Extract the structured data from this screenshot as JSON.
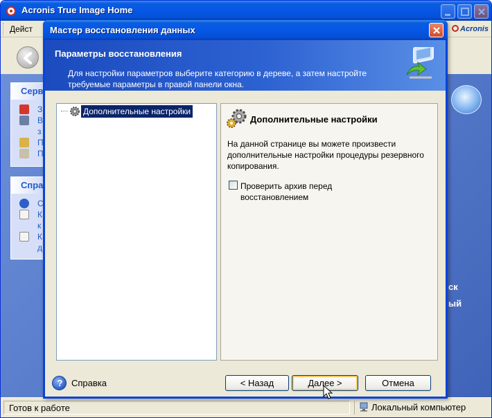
{
  "main_window": {
    "title": "Acronis True Image Home",
    "menu_action": "Дейст",
    "brand": "Acronis",
    "status_text": "Готов к работе",
    "status_computer": "Локальный компьютер"
  },
  "sidebar": {
    "services": {
      "heading": "Серв",
      "items": [
        {
          "text": "З",
          "icon": "restore-icon"
        },
        {
          "text": "В",
          "icon": "wizard-icon"
        },
        {
          "text": "з",
          "icon": ""
        },
        {
          "text": "П",
          "icon": "tasks-icon"
        },
        {
          "text": "П",
          "icon": "search-icon"
        }
      ]
    },
    "help": {
      "heading": "Спра",
      "items": [
        {
          "text": "С",
          "icon": "help-icon"
        },
        {
          "text": "К",
          "icon": "doc-icon"
        },
        {
          "text": "к",
          "icon": ""
        },
        {
          "text": "К",
          "icon": "doc-icon"
        },
        {
          "text": "д",
          "icon": ""
        }
      ]
    }
  },
  "background_text": [
    "ск",
    "ый"
  ],
  "dialog": {
    "title": "Мастер восстановления данных",
    "step_title": "Параметры восстановления",
    "step_description": "Для настройки параметров выберите категорию в дереве, а затем настройте требуемые параметры в правой панели окна.",
    "tree": {
      "selected_node": "Дополнительные настройки"
    },
    "settings": {
      "title": "Дополнительные настройки",
      "description": "На данной странице вы можете произвести дополнительные настройки процедуры резервного копирования.",
      "checkbox_label": "Проверить архив перед восстановлением",
      "checkbox_checked": false
    },
    "help_label": "Справка",
    "buttons": {
      "back": "< Назад",
      "next": "Далее >",
      "cancel": "Отмена"
    }
  },
  "colors": {
    "titlebar_blue": "#0657e6",
    "selection": "#0a246a",
    "dialog_header": "#2d62d2",
    "face": "#ece9d8"
  }
}
